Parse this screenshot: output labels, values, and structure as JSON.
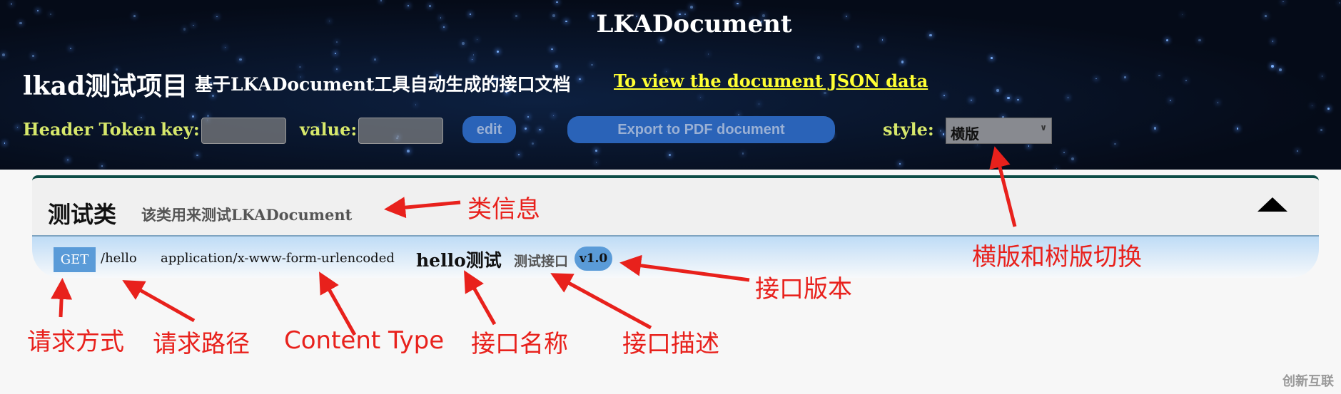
{
  "header": {
    "title": "LKADocument",
    "project_name": "lkad测试项目",
    "subtitle": "基于LKADocument工具自动生成的接口文档",
    "json_link": "To view the document JSON data",
    "token_label": "Header Token",
    "key_label": "key:",
    "key_value": "",
    "value_label": "value:",
    "value_value": "",
    "edit_label": "edit",
    "export_label": "Export to PDF document",
    "style_label": "style:",
    "style_selected": "横版"
  },
  "class_panel": {
    "name": "测试类",
    "description": "该类用来测试LKADocument",
    "collapse_icon": "triangle-up-icon",
    "api": {
      "method": "GET",
      "path": "/hello",
      "content_type": "application/x-www-form-urlencoded",
      "name": "hello测试",
      "description": "测试接口",
      "version": "v1.0"
    }
  },
  "annotations": {
    "class_info": "类信息",
    "method": "请求方式",
    "path": "请求路径",
    "content_type": "Content Type",
    "name": "接口名称",
    "description": "接口描述",
    "version": "接口版本",
    "style_switch": "横版和树版切换"
  },
  "watermark": "创新互联",
  "colors": {
    "annotation": "#e8211c",
    "header_accent": "#d7e86b",
    "link": "#ffff33",
    "badge": "#5a9bd8",
    "panel_border": "#0d4d47"
  }
}
